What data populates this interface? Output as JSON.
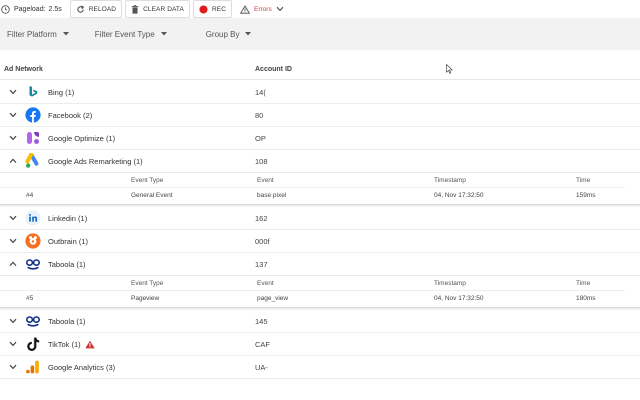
{
  "toolbar": {
    "pageload_label": "Pageload:",
    "pageload_value": "2.5s",
    "reload_label": "RELOAD",
    "clear_label": "CLEAR DATA",
    "rec_label": "REC",
    "errors_label": "Errors"
  },
  "filters": {
    "platform": "Filter Platform",
    "event_type": "Filter Event Type",
    "group_by": "Group By"
  },
  "table": {
    "col_network": "Ad Network",
    "col_account": "Account ID",
    "detail_headers": {
      "type": "Event Type",
      "event": "Event",
      "timestamp": "Timestamp",
      "time": "Time"
    },
    "rows": [
      {
        "name": "Bing (1)",
        "account": "14(",
        "icon": "bing-icon",
        "expanded": false
      },
      {
        "name": "Facebook (2)",
        "account": "80",
        "icon": "facebook-icon",
        "expanded": false
      },
      {
        "name": "Google Optimize (1)",
        "account": "OP",
        "icon": "google-optimize-icon",
        "expanded": false
      },
      {
        "name": "Google Ads Remarketing (1)",
        "account": "108",
        "icon": "google-ads-icon",
        "expanded": true,
        "events": [
          {
            "num": "#4",
            "type": "General Event",
            "event": "base pixel",
            "timestamp": "04, Nov 17:32:50",
            "time": "159ms"
          }
        ]
      },
      {
        "name": "Linkedin (1)",
        "account": "162",
        "icon": "linkedin-icon",
        "expanded": false
      },
      {
        "name": "Outbrain (1)",
        "account": "000f",
        "icon": "outbrain-icon",
        "expanded": false
      },
      {
        "name": "Taboola (1)",
        "account": "137",
        "icon": "taboola-icon",
        "expanded": true,
        "events": [
          {
            "num": "#5",
            "type": "Pageview",
            "event": "page_view",
            "timestamp": "04, Nov 17:32:50",
            "time": "180ms"
          }
        ]
      },
      {
        "name": "Taboola (1)",
        "account": "145",
        "icon": "taboola-icon",
        "expanded": false
      },
      {
        "name": "TikTok (1)",
        "account": "CAF",
        "icon": "tiktok-icon",
        "expanded": false,
        "warning": true
      },
      {
        "name": "Google Analytics (3)",
        "account": "UA-",
        "icon": "google-analytics-icon",
        "expanded": false
      }
    ]
  },
  "colors": {
    "filter_bg": "#f2f2f2",
    "rec_red": "#e21b1b",
    "error_red": "#d03b3b",
    "warning_red": "#d32f2f"
  }
}
